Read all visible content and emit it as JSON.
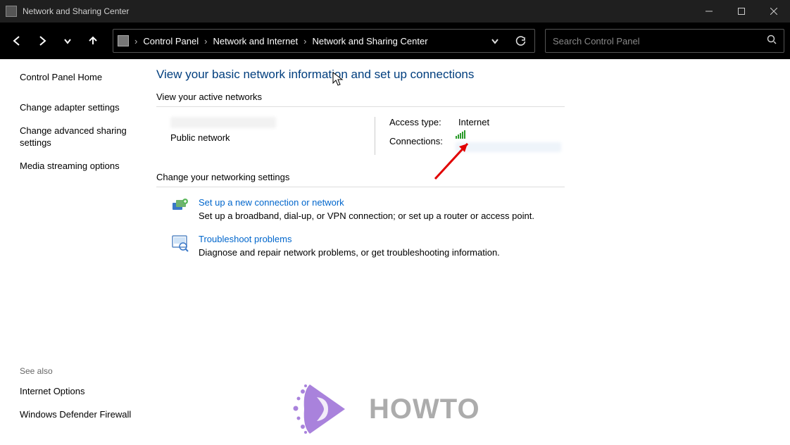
{
  "window": {
    "title": "Network and Sharing Center"
  },
  "breadcrumb": {
    "items": [
      "Control Panel",
      "Network and Internet",
      "Network and Sharing Center"
    ]
  },
  "search": {
    "placeholder": "Search Control Panel"
  },
  "sidebar": {
    "home": "Control Panel Home",
    "links": [
      "Change adapter settings",
      "Change advanced sharing settings",
      "Media streaming options"
    ],
    "see_also_title": "See also",
    "see_also": [
      "Internet Options",
      "Windows Defender Firewall"
    ]
  },
  "main": {
    "heading": "View your basic network information and set up connections",
    "active_networks_label": "View your active networks",
    "network": {
      "type_label": "Public network",
      "access_type_label": "Access type:",
      "access_type_value": "Internet",
      "connections_label": "Connections:"
    },
    "change_settings_label": "Change your networking settings",
    "tasks": [
      {
        "link": "Set up a new connection or network",
        "desc": "Set up a broadband, dial-up, or VPN connection; or set up a router or access point."
      },
      {
        "link": "Troubleshoot problems",
        "desc": "Diagnose and repair network problems, or get troubleshooting information."
      }
    ]
  },
  "watermark": {
    "text": "HOWTO"
  }
}
